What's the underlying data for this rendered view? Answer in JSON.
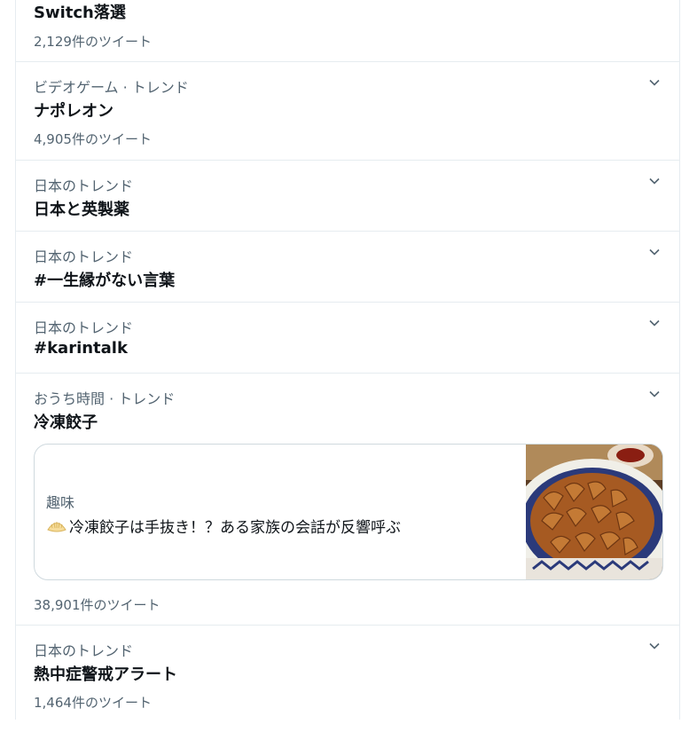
{
  "trends": [
    {
      "context": "",
      "title": "Switch落選",
      "count": "2,129件のツイート"
    },
    {
      "context": "ビデオゲーム · トレンド",
      "title": "ナポレオン",
      "count": "4,905件のツイート"
    },
    {
      "context": "日本のトレンド",
      "title": "日本と英製薬",
      "count": ""
    },
    {
      "context": "日本のトレンド",
      "title": "#一生縁がない言葉",
      "count": ""
    },
    {
      "context": "日本のトレンド",
      "title": "#karintalk",
      "count": ""
    },
    {
      "context": "おうち時間 · トレンド",
      "title": "冷凍餃子",
      "count": "38,901件のツイート",
      "card": {
        "category": "趣味",
        "headline": "冷凍餃子は手抜き！？ある家族の会話が反響呼ぶ",
        "icon": "dumpling-emoji",
        "image": "gyoza-photo"
      }
    },
    {
      "context": "日本のトレンド",
      "title": "熱中症警戒アラート",
      "count": "1,464件のツイート"
    }
  ],
  "icons": {
    "more": "chevron-down-icon"
  },
  "colors": {
    "secondary_text": "#536471",
    "primary_text": "#0f1419",
    "divider": "#e6ecf0"
  }
}
